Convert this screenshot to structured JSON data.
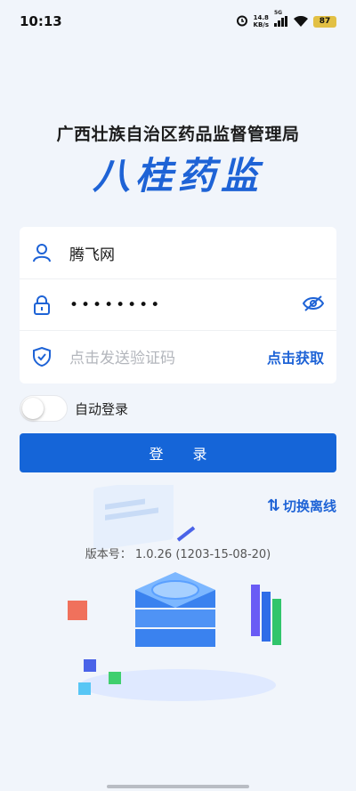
{
  "status": {
    "time": "10:13",
    "net_speed_value": "14.8",
    "net_speed_unit": "KB/s",
    "network_label": "5G",
    "battery": "87"
  },
  "header": {
    "agency": "广西壮族自治区药品监督管理局",
    "brand": "八桂药监"
  },
  "form": {
    "username": "腾飞网",
    "password_masked": "••••••••",
    "code_placeholder": "点击发送验证码",
    "get_code_label": "点击获取"
  },
  "auto_login_label": "自动登录",
  "auto_login_enabled": false,
  "login_button": "登 录",
  "switch_offline_label": "切换离线",
  "version": "版本号： 1.0.26 (1203-15-08-20)",
  "colors": {
    "primary": "#1565d8",
    "background": "#f1f5fb"
  }
}
